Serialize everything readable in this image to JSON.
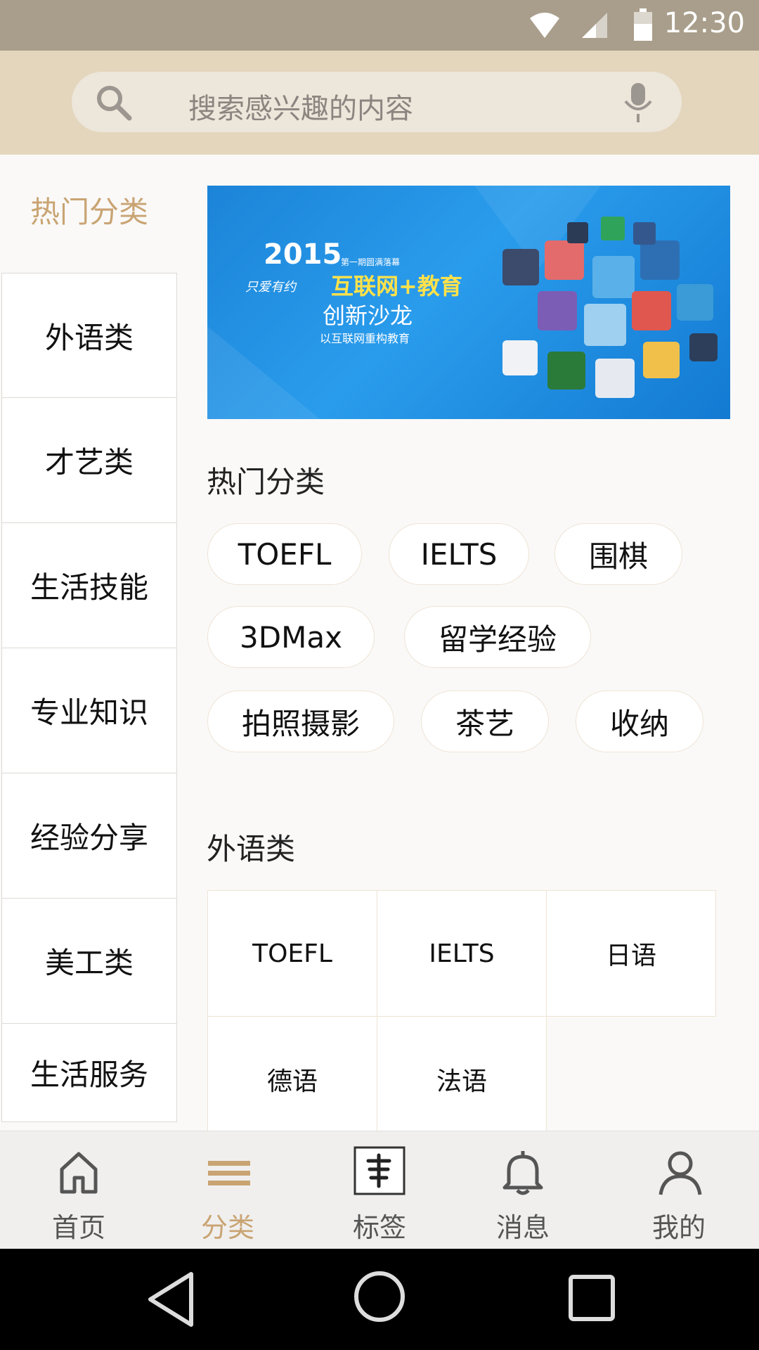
{
  "status_bar": {
    "time": "12:30",
    "icons": [
      "wifi-icon",
      "cell-signal-icon",
      "battery-icon"
    ]
  },
  "search": {
    "placeholder": "搜索感兴趣的内容",
    "icons": [
      "search-icon",
      "microphone-icon"
    ]
  },
  "sidebar": {
    "title": "热门分类",
    "items": [
      {
        "label": "外语类"
      },
      {
        "label": "才艺类"
      },
      {
        "label": "生活技能"
      },
      {
        "label": "专业知识"
      },
      {
        "label": "经验分享"
      },
      {
        "label": "美工类"
      },
      {
        "label": "生活服务"
      }
    ]
  },
  "banner": {
    "year": "2015",
    "top_line": "第一期圆满落幕",
    "title": "互联网+教育",
    "subtitle": "创新沙龙",
    "tagline": "以互联网重构教育",
    "signature": "只爱有约"
  },
  "hot_section": {
    "title": "热门分类",
    "tags": [
      "TOEFL",
      "IELTS",
      "围棋",
      "3DMax",
      "留学经验",
      "拍照摄影",
      "茶艺",
      "收纳"
    ]
  },
  "language_section": {
    "title": "外语类",
    "items": [
      "TOEFL",
      "IELTS",
      "日语",
      "德语",
      "法语"
    ]
  },
  "tabbar": {
    "tabs": [
      {
        "label": "首页",
        "icon": "home-icon"
      },
      {
        "label": "分类",
        "icon": "menu-icon",
        "active": true
      },
      {
        "label": "标签",
        "icon": "tag-stamp-icon"
      },
      {
        "label": "消息",
        "icon": "bell-icon"
      },
      {
        "label": "我的",
        "icon": "user-icon"
      }
    ]
  },
  "colors": {
    "accent": "#c9a473",
    "search_bar": "#e3d6bd",
    "status_bar": "#a99e8b"
  }
}
